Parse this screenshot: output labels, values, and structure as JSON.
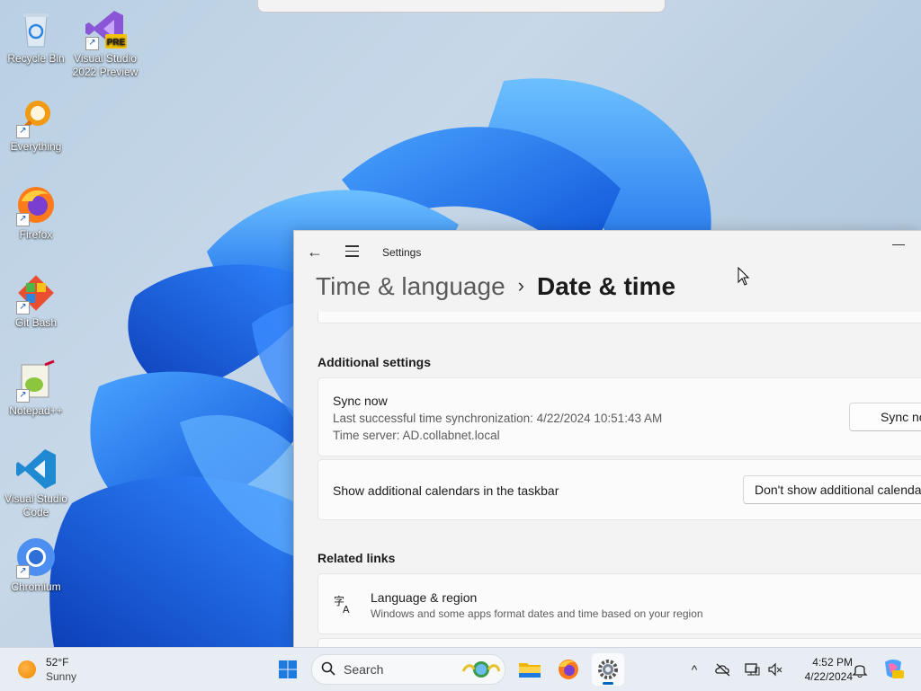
{
  "desktop": {
    "icons": [
      {
        "label": "Recycle Bin",
        "icon": "recycle-bin-icon"
      },
      {
        "label": "Visual Studio 2022 Preview",
        "icon": "visual-studio-preview-icon",
        "badge": "PRE"
      },
      {
        "label": "Everything",
        "icon": "everything-search-icon"
      },
      {
        "label": "Firefox",
        "icon": "firefox-icon"
      },
      {
        "label": "Git Bash",
        "icon": "git-bash-icon"
      },
      {
        "label": "Notepad++",
        "icon": "notepad-plus-plus-icon"
      },
      {
        "label": "Visual Studio Code",
        "icon": "vscode-icon"
      },
      {
        "label": "Chromium",
        "icon": "chromium-icon"
      }
    ]
  },
  "settings": {
    "app_title": "Settings",
    "back_glyph": "←",
    "minimize_glyph": "—",
    "breadcrumb": {
      "parent": "Time & language",
      "separator": "›",
      "current": "Date & time"
    },
    "additional": {
      "title": "Additional settings",
      "sync": {
        "label": "Sync now",
        "last_sync": "Last successful time synchronization: 4/22/2024 10:51:43 AM",
        "server": "Time server: AD.collabnet.local",
        "button": "Sync now"
      },
      "calendars": {
        "label": "Show additional calendars in the taskbar",
        "selected": "Don't show additional calendars"
      }
    },
    "related": {
      "title": "Related links",
      "language_region": {
        "label": "Language & region",
        "desc": "Windows and some apps format dates and time based on your region"
      }
    }
  },
  "taskbar": {
    "weather": {
      "temp": "52°F",
      "condition": "Sunny"
    },
    "search_placeholder": "Search",
    "pinned": [
      "start-icon",
      "file-explorer-icon",
      "firefox-icon",
      "settings-icon"
    ],
    "active_app": "settings-icon",
    "clock": {
      "time": "4:52 PM",
      "date": "4/22/2024"
    },
    "colors": {
      "accent": "#0067c0"
    }
  }
}
